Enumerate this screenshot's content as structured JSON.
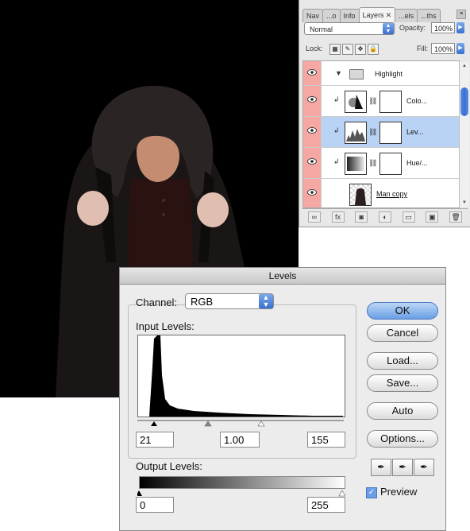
{
  "layers_panel": {
    "tabs": [
      {
        "label": "Nav",
        "active": false
      },
      {
        "label": "...o",
        "active": false
      },
      {
        "label": "Info",
        "active": false
      },
      {
        "label": "Layers",
        "active": true
      },
      {
        "label": "...els",
        "active": false
      },
      {
        "label": "...ths",
        "active": false
      }
    ],
    "blend_mode": "Normal",
    "opacity_label": "Opacity:",
    "opacity_value": "100%",
    "lock_label": "Lock:",
    "fill_label": "Fill:",
    "fill_value": "100%",
    "layers": [
      {
        "name": "Highlight",
        "kind": "group"
      },
      {
        "name": "Colo...",
        "kind": "adjustment",
        "selected": false
      },
      {
        "name": "Lev...",
        "kind": "adjustment",
        "selected": true
      },
      {
        "name": "Hue/...",
        "kind": "adjustment",
        "selected": false
      },
      {
        "name": "Man copy",
        "kind": "pixel",
        "selected": false
      }
    ],
    "footer_icons": [
      "link-icon",
      "fx-icon",
      "mask-icon",
      "adjustment-icon",
      "folder-icon",
      "new-layer-icon",
      "trash-icon"
    ]
  },
  "levels_dialog": {
    "title": "Levels",
    "channel_label": "Channel:",
    "channel_value": "RGB",
    "input_levels_label": "Input Levels:",
    "input_black": "21",
    "input_gamma": "1.00",
    "input_white": "155",
    "output_levels_label": "Output Levels:",
    "output_black": "0",
    "output_white": "255",
    "buttons": {
      "ok": "OK",
      "cancel": "Cancel",
      "load": "Load...",
      "save": "Save...",
      "auto": "Auto",
      "options": "Options..."
    },
    "preview_label": "Preview",
    "preview_checked": true
  },
  "colors": {
    "eye_column": "#f4a7a3",
    "selected_row": "#b9d3f5",
    "accent_blue": "#3a6fd1"
  }
}
